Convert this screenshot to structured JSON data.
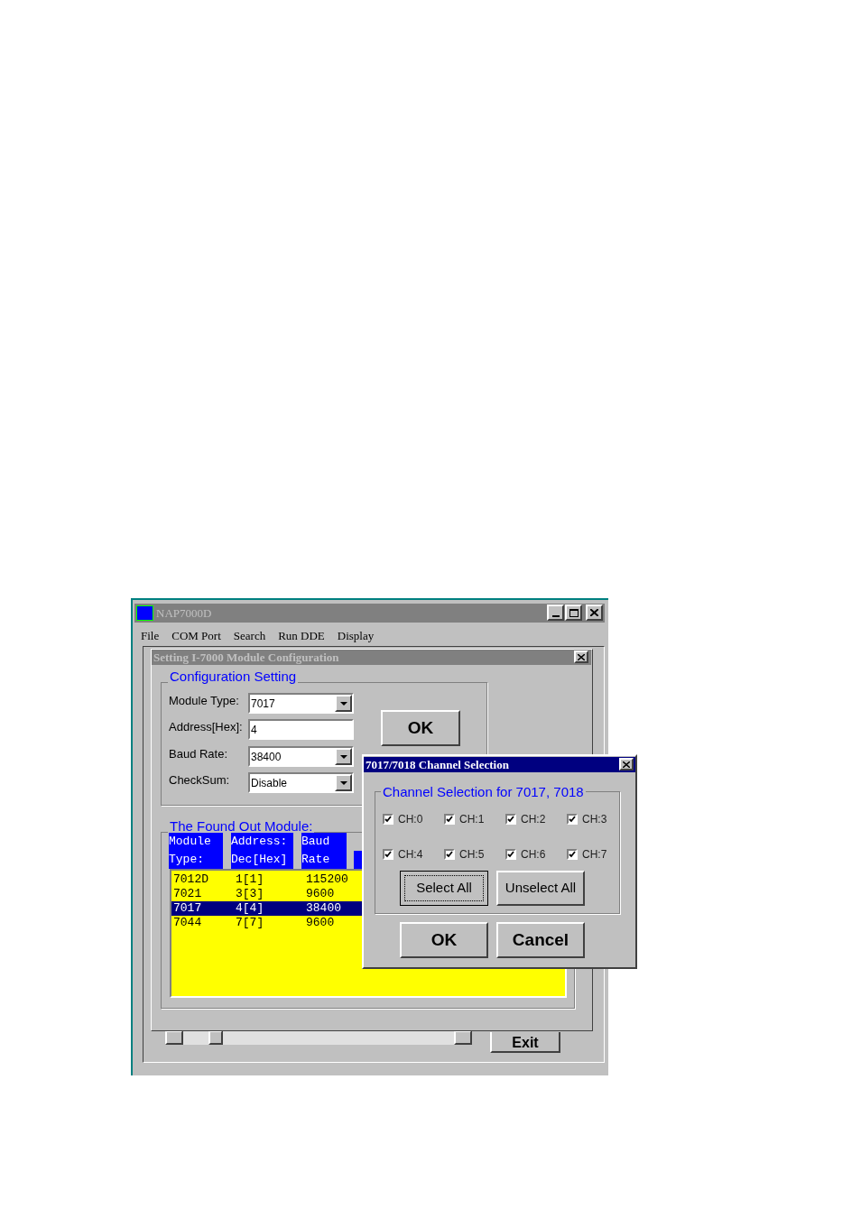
{
  "main_window": {
    "title": "NAP7000D",
    "menu": [
      "File",
      "COM Port",
      "Search",
      "Run DDE",
      "Display"
    ]
  },
  "config_dialog": {
    "title": "Setting I-7000 Module Configuration",
    "group_title": "Configuration Setting",
    "fields": [
      {
        "label": "Module Type:",
        "value": "7017",
        "kind": "dropdown"
      },
      {
        "label": "Address[Hex]:",
        "value": "4",
        "kind": "text"
      },
      {
        "label": "Baud Rate:",
        "value": "38400",
        "kind": "dropdown"
      },
      {
        "label": "CheckSum:",
        "value": "Disable",
        "kind": "dropdown"
      }
    ],
    "ok_button": "OK",
    "found_title": "The Found Out Module:",
    "header_rows": [
      [
        "Module",
        "Address:",
        "Baud"
      ],
      [
        "Type:",
        "Dec[Hex]",
        "Rate"
      ]
    ],
    "rows": [
      {
        "cells": [
          "7012D",
          "1[1]",
          "115200"
        ],
        "selected": false
      },
      {
        "cells": [
          "7021",
          "3[3]",
          "9600"
        ],
        "selected": false
      },
      {
        "cells": [
          "7017",
          "4[4]",
          "38400"
        ],
        "selected": true
      },
      {
        "cells": [
          "7044",
          "7[7]",
          "9600"
        ],
        "selected": false
      }
    ],
    "exit_button": "Exit"
  },
  "channel_dialog": {
    "title": "7017/7018 Channel Selection",
    "group_title": "Channel Selection for 7017, 7018",
    "channels": [
      {
        "label": "CH:0",
        "checked": true
      },
      {
        "label": "CH:1",
        "checked": true
      },
      {
        "label": "CH:2",
        "checked": true
      },
      {
        "label": "CH:3",
        "checked": true
      },
      {
        "label": "CH:4",
        "checked": true
      },
      {
        "label": "CH:5",
        "checked": true
      },
      {
        "label": "CH:6",
        "checked": true
      },
      {
        "label": "CH:7",
        "checked": true
      }
    ],
    "select_all": "Select All",
    "unselect_all": "Unselect All",
    "ok": "OK",
    "cancel": "Cancel"
  }
}
